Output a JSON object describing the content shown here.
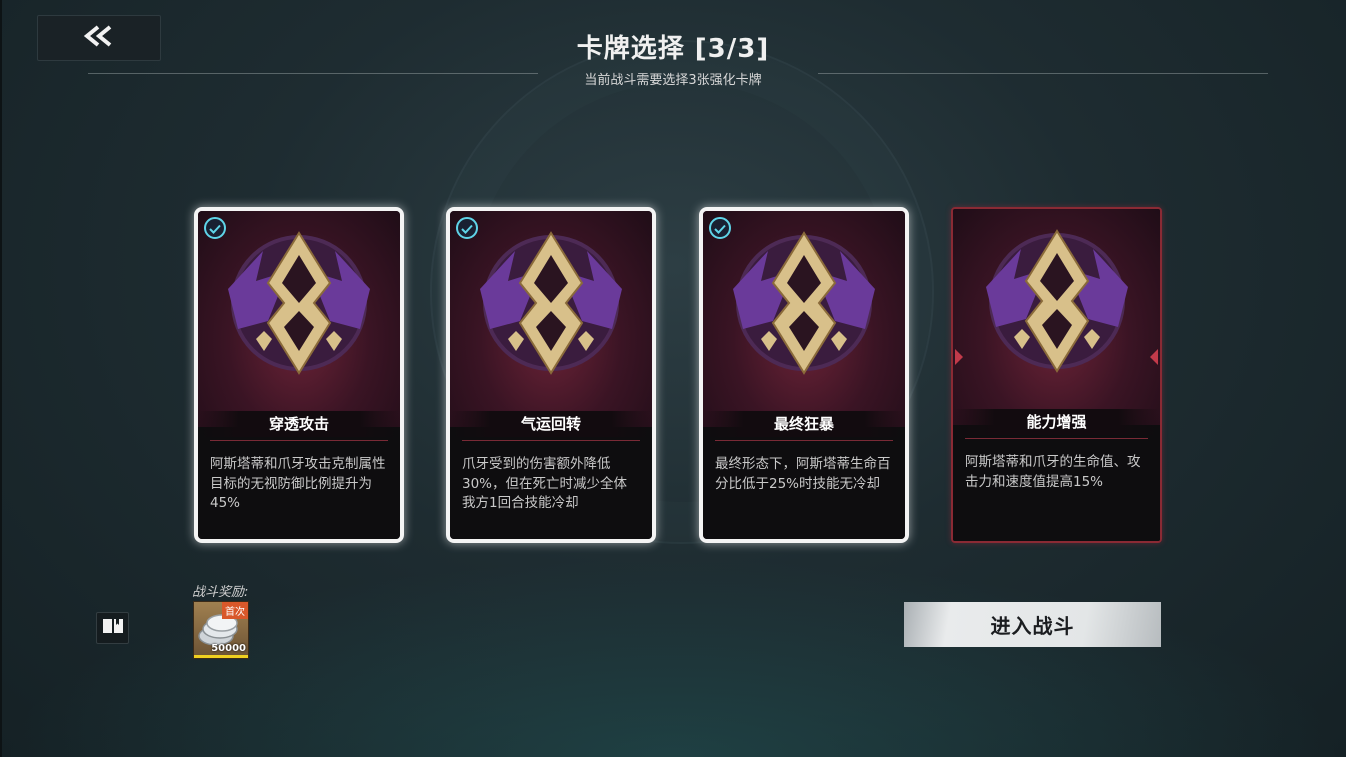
{
  "header": {
    "title": "卡牌选择 [3/3]",
    "subtitle": "当前战斗需要选择3张强化卡牌"
  },
  "icons": {
    "back": "double-chevron-left-icon",
    "check": "checkmark-circle-icon",
    "emblem": "claw-emblem-icon",
    "book": "open-book-icon",
    "reward": "silver-coin-icon"
  },
  "cards": [
    {
      "name": "穿透攻击",
      "desc": "阿斯塔蒂和爪牙攻击克制属性目标的无视防御比例提升为45%",
      "selected": true
    },
    {
      "name": "气运回转",
      "desc": "爪牙受到的伤害额外降低30%，但在死亡时减少全体我方1回合技能冷却",
      "selected": true
    },
    {
      "name": "最终狂暴",
      "desc": "最终形态下，阿斯塔蒂生命百分比低于25%时技能无冷却",
      "selected": true
    },
    {
      "name": "能力增强",
      "desc": "阿斯塔蒂和爪牙的生命值、攻击力和速度值提高15%",
      "selected": false
    }
  ],
  "reward": {
    "label": "战斗奖励:",
    "badge": "首次",
    "amount": "50000"
  },
  "actions": {
    "enter_battle": "进入战斗"
  },
  "colors": {
    "selected_border": "#f4f4f4",
    "unselected_border": "#8a2a34",
    "check_accent": "#5fd4e8",
    "emblem_purple": "#6a3a9a",
    "emblem_gold": "#d8c08a"
  }
}
